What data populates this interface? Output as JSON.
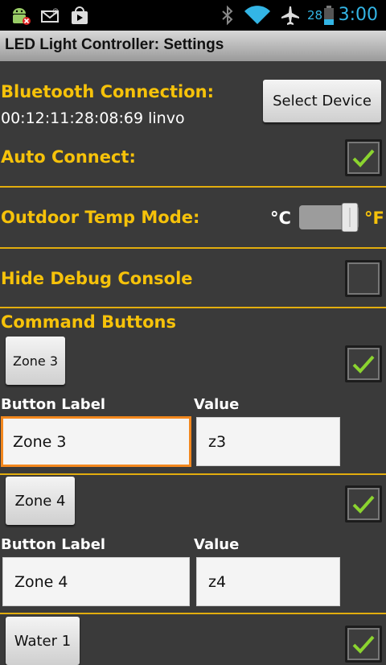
{
  "statusbar": {
    "battery_level": "28",
    "time": "3:00"
  },
  "titlebar": {
    "title": "LED Light Controller:  Settings"
  },
  "bluetooth": {
    "label": "Bluetooth Connection:",
    "device": "00:12:11:28:08:69 linvor",
    "select_button": "Select Device"
  },
  "auto_connect": {
    "label": "Auto Connect:",
    "checked": true
  },
  "temp_mode": {
    "label": "Outdoor Temp Mode:",
    "celsius": "°C",
    "fahrenheit": "°F",
    "selected": "°F"
  },
  "debug": {
    "label": "Hide Debug Console",
    "checked": false
  },
  "commands": {
    "header": "Command Buttons",
    "label_header": "Button Label",
    "value_header": "Value",
    "items": [
      {
        "button": "Zone 3",
        "label": "Zone 3",
        "value": "z3",
        "checked": true
      },
      {
        "button": "Zone 4",
        "label": "Zone 4",
        "value": "z4",
        "checked": true
      },
      {
        "button": "Water 1",
        "checked": true
      }
    ]
  },
  "colors": {
    "accent": "#f6c20a",
    "divider": "#e2ad0e",
    "check": "#8bd42f",
    "focus": "#f2871d",
    "background": "#3a3a3a",
    "clock": "#33b5e5"
  }
}
